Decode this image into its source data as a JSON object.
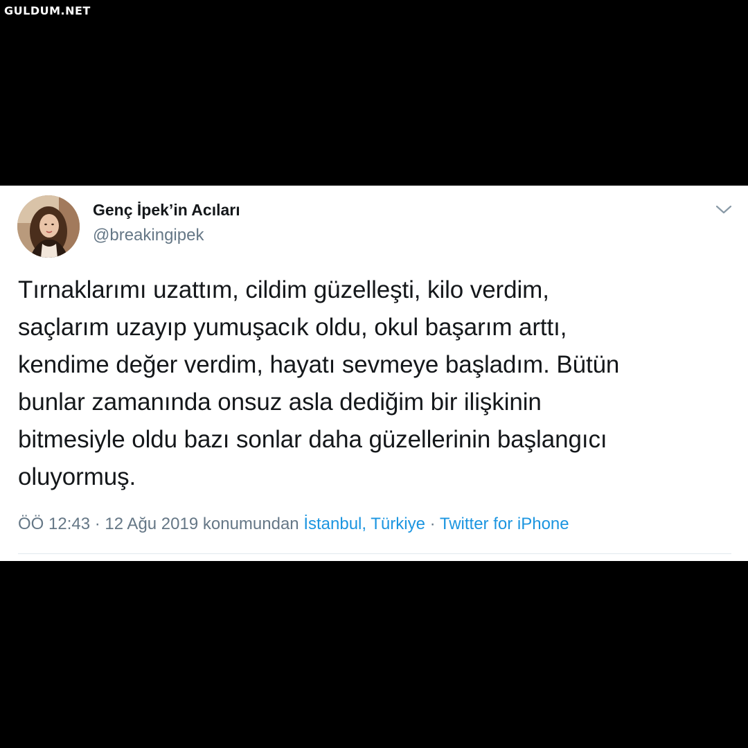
{
  "watermark": "GULDUM.NET",
  "tweet": {
    "author_name": "Genç İpek’in Acıları",
    "author_handle": "@breakingipek",
    "text_lines": [
      "Tırnaklarımı uzattım, cildim güzelleşti, kilo verdim,",
      "saçlarım uzayıp yumuşacık oldu, okul başarım arttı,",
      "kendime değer verdim, hayatı sevmeye başladım. Bütün",
      "bunlar zamanında onsuz asla dediğim bir ilişkinin",
      "bitmesiyle oldu bazı sonlar daha güzellerinin başlangıcı",
      "oluyormuş."
    ],
    "meta": {
      "time": "ÖÖ 12:43",
      "separator": " · ",
      "date": "12 Ağu 2019",
      "location_prefix": " konumundan ",
      "location": "İstanbul, Türkiye",
      "separator2": " · ",
      "source": "Twitter for iPhone"
    },
    "icons": {
      "menu": "chevron-down-icon"
    }
  },
  "colors": {
    "background": "#000000",
    "card": "#ffffff",
    "text": "#14171a",
    "secondary": "#657786",
    "link": "#1b95e0"
  }
}
